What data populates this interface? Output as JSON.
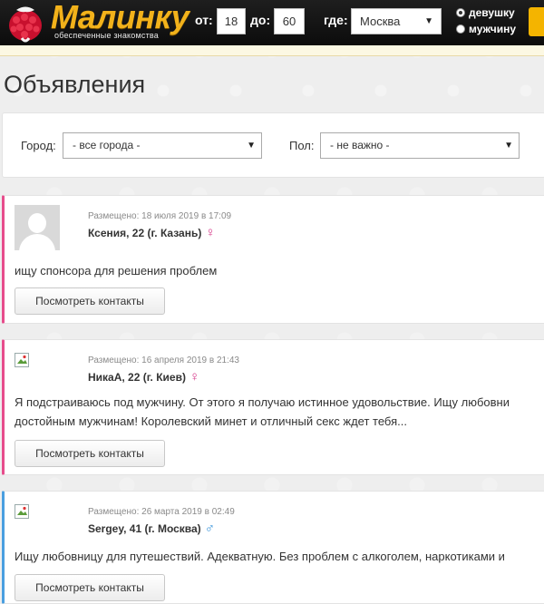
{
  "header": {
    "logo_text": "Малинку",
    "logo_subtitle": "обеспеченные знакомства",
    "age_from_label": "от:",
    "age_from_value": "18",
    "age_to_label": "до:",
    "age_to_value": "60",
    "city_label": "где:",
    "city_value": "Москва",
    "gender_options": [
      {
        "label": "девушку",
        "selected": true
      },
      {
        "label": "мужчину",
        "selected": false
      }
    ]
  },
  "page_title": "Объявления",
  "filters": {
    "city_label": "Город:",
    "city_value": "- все города -",
    "gender_label": "Пол:",
    "gender_value": "- не важно -"
  },
  "ads": [
    {
      "posted": "Размещено: 18 июля 2019 в 17:09",
      "name": "Ксения, 22 (г. Казань)",
      "gender": "female",
      "text_lines": [
        "ищу спонсора для решения проблем"
      ],
      "button": "Посмотреть контакты",
      "avatar": "placeholder"
    },
    {
      "posted": "Размещено: 16 апреля 2019 в 21:43",
      "name": "НикаА, 22 (г. Киев)",
      "gender": "female",
      "text_lines": [
        "Я подстраиваюсь под мужчину. От этого я получаю истинное удовольствие. Ищу любовни",
        "достойным мужчинам! Королевский минет и отличный секс ждет тебя..."
      ],
      "button": "Посмотреть контакты",
      "avatar": "broken"
    },
    {
      "posted": "Размещено: 26 марта 2019 в 02:49",
      "name": "Sergey, 41 (г. Москва)",
      "gender": "male",
      "text_lines": [
        "Ищу любовницу для путешествий. Адекватную. Без проблем с алкоголем, наркотиками и"
      ],
      "button": "Посмотреть контакты",
      "avatar": "broken"
    }
  ],
  "gender_symbols": {
    "female": "♀",
    "male": "♂"
  },
  "colors": {
    "brand_gold": "#f2b21b",
    "female_accent": "#e64d8c",
    "male_accent": "#4a9fe0"
  }
}
